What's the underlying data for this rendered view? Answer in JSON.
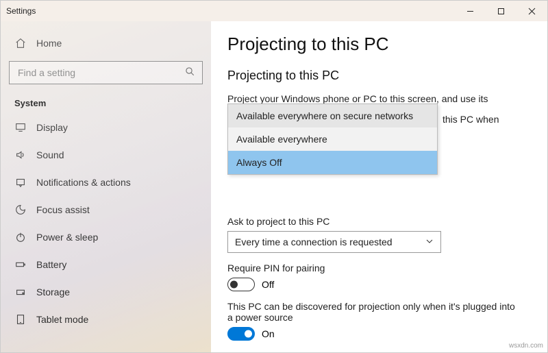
{
  "window": {
    "title": "Settings"
  },
  "sidebar": {
    "home": "Home",
    "search_placeholder": "Find a setting",
    "category": "System",
    "items": [
      {
        "label": "Display"
      },
      {
        "label": "Sound"
      },
      {
        "label": "Notifications & actions"
      },
      {
        "label": "Focus assist"
      },
      {
        "label": "Power & sleep"
      },
      {
        "label": "Battery"
      },
      {
        "label": "Storage"
      },
      {
        "label": "Tablet mode"
      }
    ]
  },
  "main": {
    "page_title": "Projecting to this PC",
    "section_title": "Projecting to this PC",
    "desc": "Project your Windows phone or PC to this screen, and use its keyboard, mouse, and other devices, too.",
    "behind_fragment": "this PC when",
    "dropdown1_options": [
      "Available everywhere on secure networks",
      "Available everywhere",
      "Always Off"
    ],
    "ask_label": "Ask to project to this PC",
    "ask_value": "Every time a connection is requested",
    "pin_label": "Require PIN for pairing",
    "pin_state": "Off",
    "discover_label": "This PC can be discovered for projection only when it's plugged into a power source",
    "discover_state": "On"
  },
  "watermark": "wsxdn.com"
}
